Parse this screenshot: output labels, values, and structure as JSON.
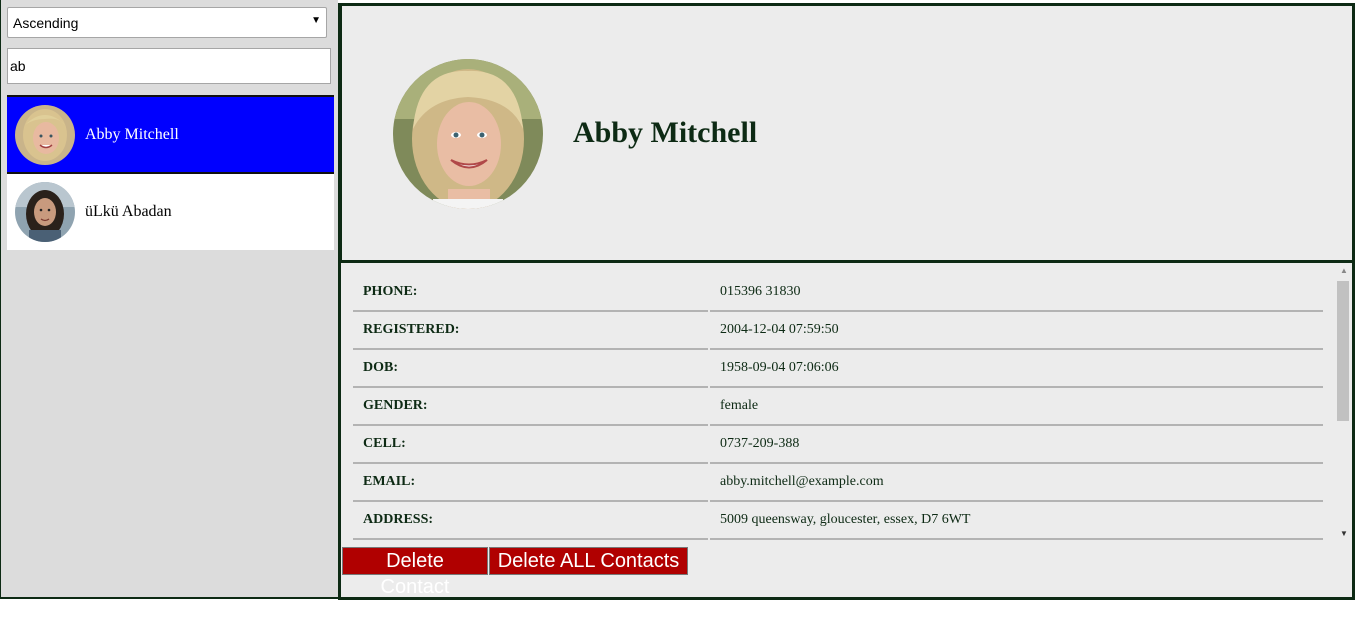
{
  "sidebar": {
    "sort": {
      "selected": "Ascending"
    },
    "search": {
      "value": "ab"
    },
    "contacts": [
      {
        "name": "Abby Mitchell",
        "active": true
      },
      {
        "name": "üLkü Abadan",
        "active": false
      }
    ]
  },
  "detail": {
    "name": "Abby Mitchell",
    "fields": [
      {
        "label": "PHONE:",
        "value": "015396 31830"
      },
      {
        "label": "REGISTERED:",
        "value": "2004-12-04 07:59:50"
      },
      {
        "label": "DOB:",
        "value": "1958-09-04 07:06:06"
      },
      {
        "label": "GENDER:",
        "value": "female"
      },
      {
        "label": "CELL:",
        "value": "0737-209-388"
      },
      {
        "label": "EMAIL:",
        "value": "abby.mitchell@example.com"
      },
      {
        "label": "ADDRESS:",
        "value": "5009 queensway, gloucester, essex, D7 6WT"
      }
    ]
  },
  "actions": {
    "delete_contact": "Delete Contact",
    "delete_all": "Delete ALL Contacts"
  },
  "colors": {
    "accent_blue": "#0000ff",
    "dark_green": "#0d2a14",
    "danger_red": "#b00000"
  }
}
